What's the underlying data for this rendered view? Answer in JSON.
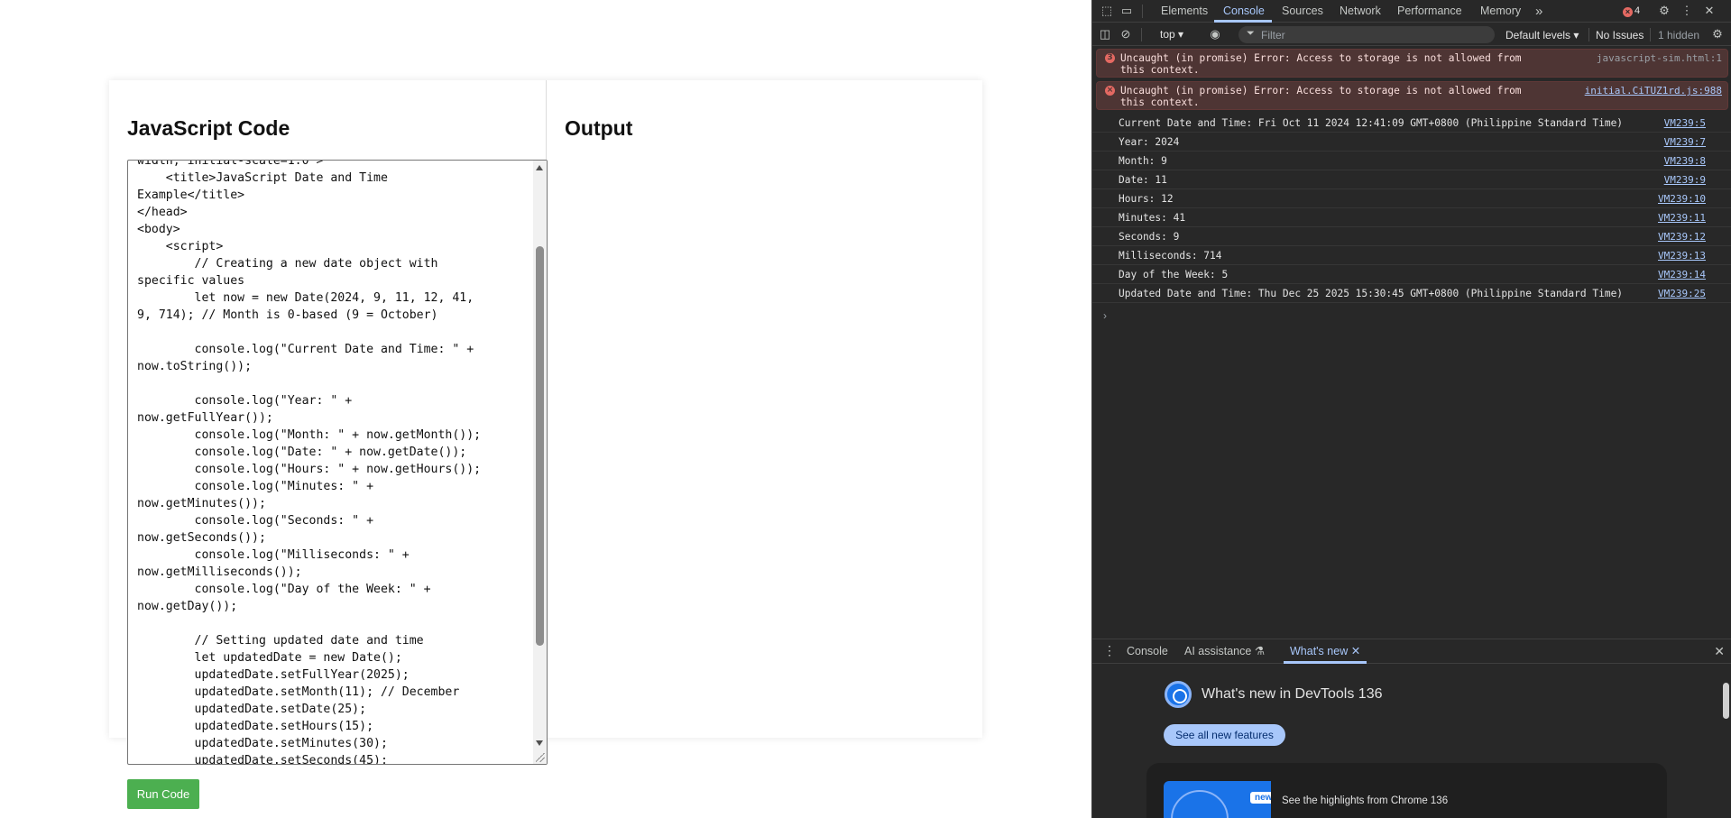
{
  "page": {
    "code_title": "JavaScript Code",
    "output_title": "Output",
    "run_button": "Run Code",
    "code_text": "width, initial-scale=1.0\">\n    <title>JavaScript Date and Time\nExample</title>\n</head>\n<body>\n    <script>\n        // Creating a new date object with\nspecific values\n        let now = new Date(2024, 9, 11, 12, 41,\n9, 714); // Month is 0-based (9 = October)\n\n        console.log(\"Current Date and Time: \" +\nnow.toString());\n\n        console.log(\"Year: \" +\nnow.getFullYear());\n        console.log(\"Month: \" + now.getMonth());\n        console.log(\"Date: \" + now.getDate());\n        console.log(\"Hours: \" + now.getHours());\n        console.log(\"Minutes: \" +\nnow.getMinutes());\n        console.log(\"Seconds: \" +\nnow.getSeconds());\n        console.log(\"Milliseconds: \" +\nnow.getMilliseconds());\n        console.log(\"Day of the Week: \" +\nnow.getDay());\n\n        // Setting updated date and time\n        let updatedDate = new Date();\n        updatedDate.setFullYear(2025);\n        updatedDate.setMonth(11); // December\n        updatedDate.setDate(25);\n        updatedDate.setHours(15);\n        updatedDate.setMinutes(30);\n        updatedDate.setSeconds(45);"
  },
  "devtools": {
    "tabs": [
      "Elements",
      "Console",
      "Sources",
      "Network",
      "Performance",
      "Memory"
    ],
    "more_tabs": "»",
    "error_count": "4",
    "toolbar": {
      "context": "top",
      "filter_placeholder": "Filter",
      "levels": "Default levels",
      "issues": "No Issues",
      "hidden": "1 hidden"
    },
    "errors": [
      {
        "badge": "3",
        "text": "Uncaught (in promise) Error: Access to storage is not allowed from this context.",
        "source": "javascript-sim.html:1"
      },
      {
        "badge": "×",
        "text": "Uncaught (in promise) Error: Access to storage is not allowed from this context.",
        "source": "initial.CiTUZ1rd.js:988"
      }
    ],
    "logs": [
      {
        "text": "Current Date and Time: Fri Oct 11 2024 12:41:09 GMT+0800 (Philippine Standard Time)",
        "source": "VM239:5"
      },
      {
        "text": "Year: 2024",
        "source": "VM239:7"
      },
      {
        "text": "Month: 9",
        "source": "VM239:8"
      },
      {
        "text": "Date: 11",
        "source": "VM239:9"
      },
      {
        "text": "Hours: 12",
        "source": "VM239:10"
      },
      {
        "text": "Minutes: 41",
        "source": "VM239:11"
      },
      {
        "text": "Seconds: 9",
        "source": "VM239:12"
      },
      {
        "text": "Milliseconds: 714",
        "source": "VM239:13"
      },
      {
        "text": "Day of the Week: 5",
        "source": "VM239:14"
      },
      {
        "text": "Updated Date and Time: Thu Dec 25 2025 15:30:45 GMT+0800 (Philippine Standard Time)",
        "source": "VM239:25"
      }
    ],
    "prompt": "›",
    "drawer": {
      "tabs": [
        "Console",
        "AI assistance",
        "What's new"
      ],
      "whats_new_title": "What's new in DevTools 136",
      "see_all_button": "See all new features",
      "new_badge": "new",
      "highlight_text": "See the highlights from Chrome 136"
    }
  }
}
